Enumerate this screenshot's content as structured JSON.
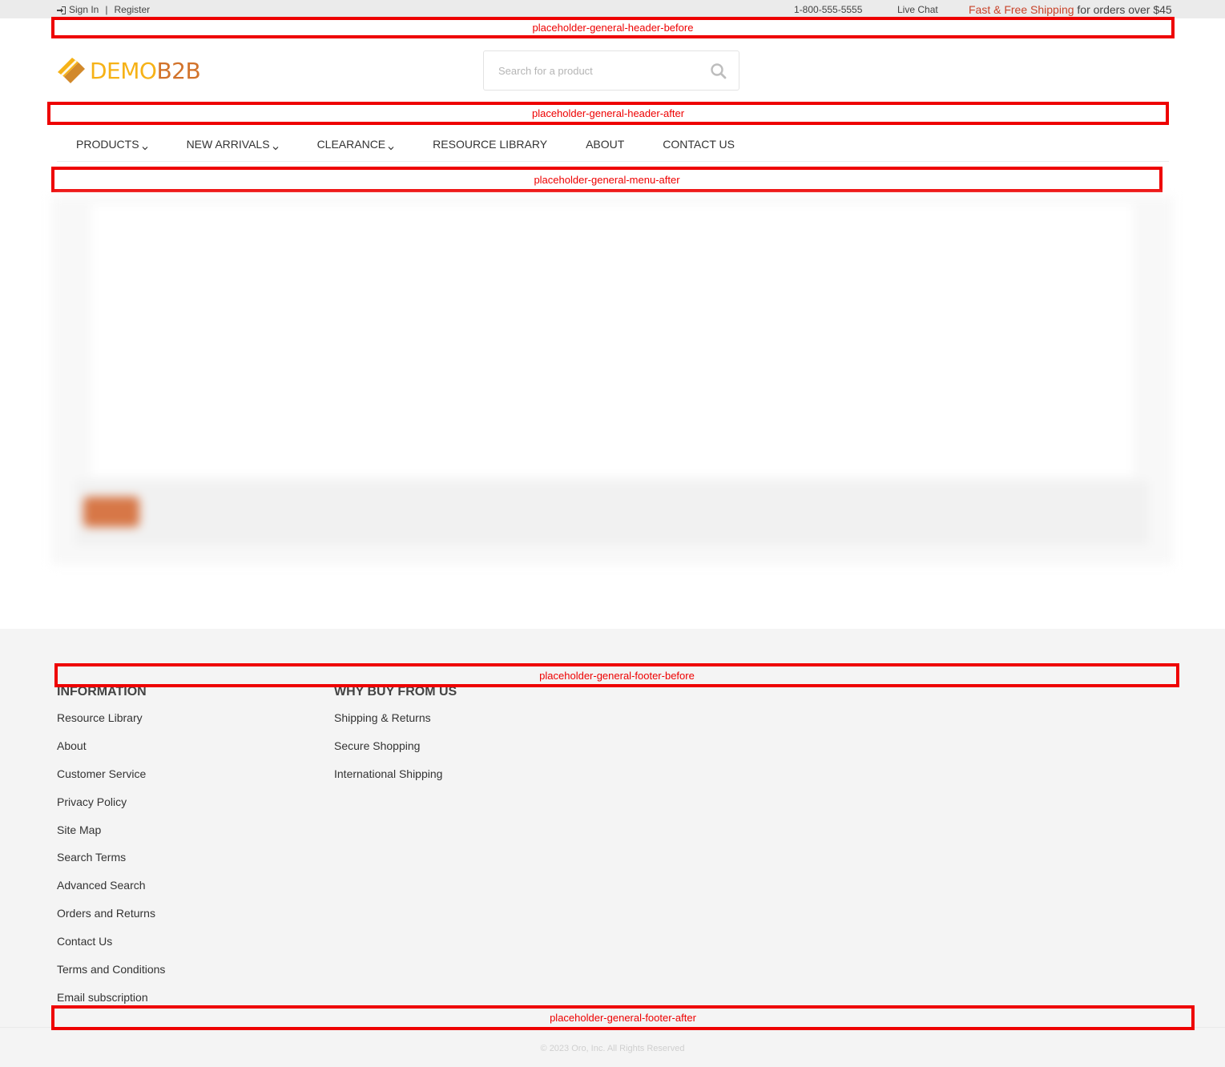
{
  "topbar": {
    "sign_in": "Sign In",
    "separator": "|",
    "register": "Register",
    "phone": "1-800-555-5555",
    "live_chat": "Live Chat",
    "shipping_accent": "Fast & Free Shipping",
    "shipping_rest": " for orders over $45"
  },
  "placeholders": {
    "header_before": "placeholder-general-header-before",
    "header_after": "placeholder-general-header-after",
    "menu_after": "placeholder-general-menu-after",
    "footer_before": "placeholder-general-footer-before",
    "footer_after": "placeholder-general-footer-after"
  },
  "logo": {
    "demo": "DEMO",
    "b2b": "B2B",
    "colors": {
      "demo": "#f6b217",
      "b2b": "#d2732b"
    }
  },
  "search": {
    "placeholder": "Search for a product",
    "icon": "search-icon"
  },
  "nav": {
    "items": [
      {
        "label": "PRODUCTS",
        "has_dropdown": true
      },
      {
        "label": "NEW ARRIVALS",
        "has_dropdown": true
      },
      {
        "label": "CLEARANCE",
        "has_dropdown": true
      },
      {
        "label": "RESOURCE LIBRARY",
        "has_dropdown": false
      },
      {
        "label": "ABOUT",
        "has_dropdown": false
      },
      {
        "label": "CONTACT US",
        "has_dropdown": false
      }
    ]
  },
  "footer": {
    "information": {
      "title": "INFORMATION",
      "links": [
        "Resource Library",
        "About",
        "Customer Service",
        "Privacy Policy",
        "Site Map",
        "Search Terms",
        "Advanced Search",
        "Orders and Returns",
        "Contact Us",
        "Terms and Conditions",
        "Email subscription"
      ]
    },
    "why_buy": {
      "title": "WHY BUY FROM US",
      "links": [
        "Shipping & Returns",
        "Secure Shopping",
        "International Shipping"
      ]
    },
    "copyright": "© 2023 Oro, Inc. All Rights Reserved"
  },
  "colors": {
    "accent": "#c8442b",
    "placeholder_border": "#ee0000",
    "footer_bg": "#f4f4f4",
    "topbar_bg": "#ebebeb"
  }
}
